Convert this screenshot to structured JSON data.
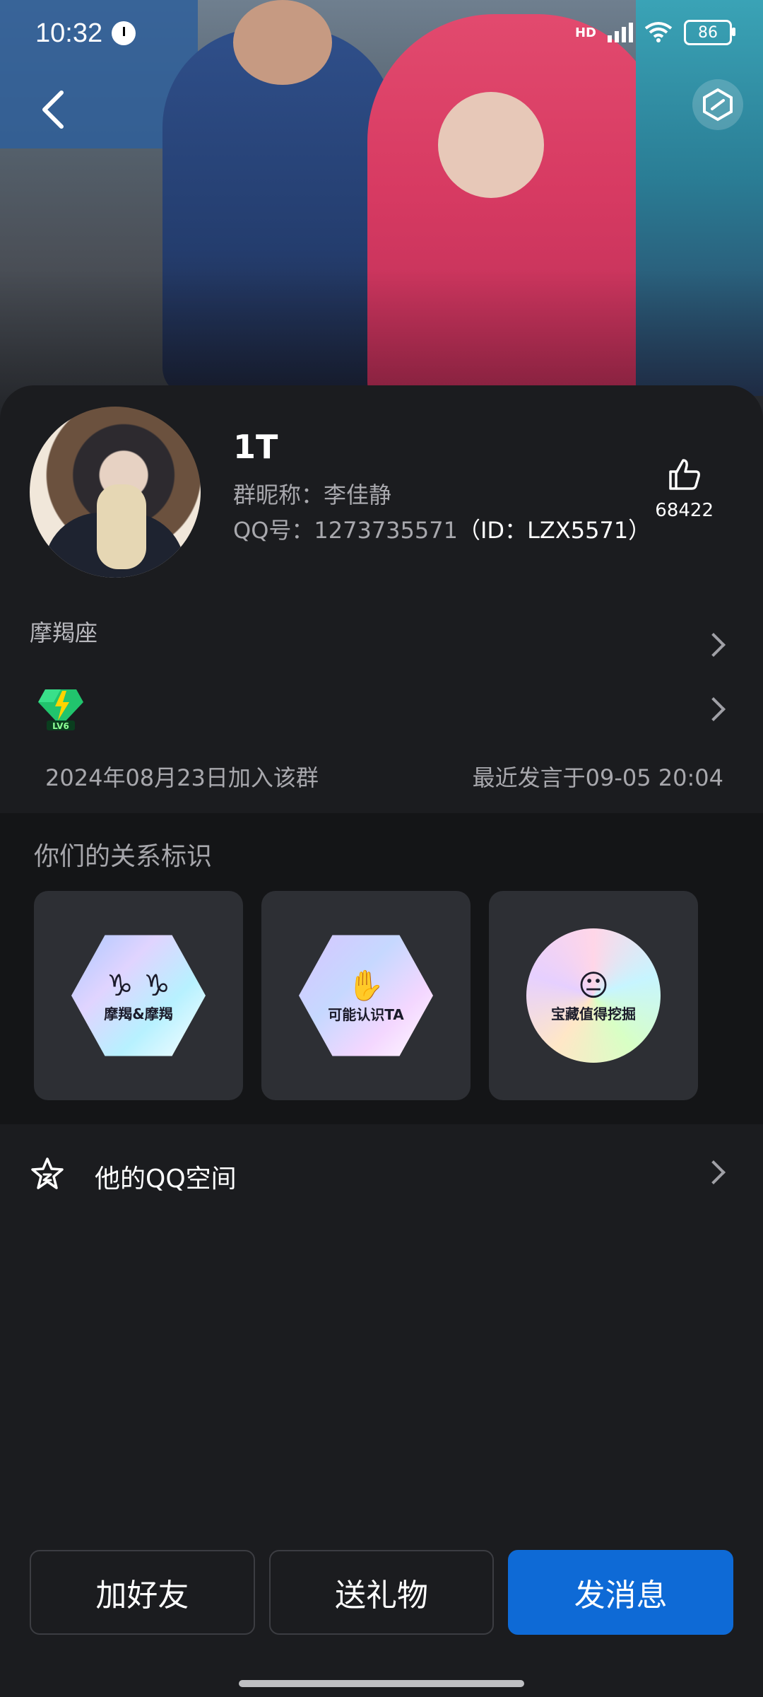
{
  "status_bar": {
    "time": "10:32",
    "battery": "86",
    "network_label": "HD"
  },
  "profile": {
    "name": "1T",
    "nickname": "群昵称：李佳静",
    "qq_prefix": "QQ号：1273735571",
    "qq_id": "（ID：LZX5571）",
    "likes": "68422"
  },
  "info": {
    "zodiac": "摩羯座",
    "level_badge": "LV6",
    "joined": "2024年08月23日加入该群",
    "last_message": "最近发言于09-05 20:04"
  },
  "relations": {
    "title": "你们的关系标识",
    "tags": [
      {
        "label": "摩羯&摩羯",
        "symbol": "♑ ♑",
        "icon": "capricorn-pair-badge"
      },
      {
        "label": "可能认识TA",
        "symbol": "✋",
        "icon": "wave-hand-badge"
      },
      {
        "label": "宝藏值得挖掘",
        "symbol": "😐",
        "icon": "treasure-face-badge"
      }
    ]
  },
  "qzone": {
    "label": "他的QQ空间"
  },
  "actions": {
    "add_friend": "加好友",
    "send_gift": "送礼物",
    "send_message": "发消息"
  },
  "colors": {
    "accent": "#0E6AD6",
    "background": "#1B1C1F",
    "section_bg": "#141517"
  }
}
